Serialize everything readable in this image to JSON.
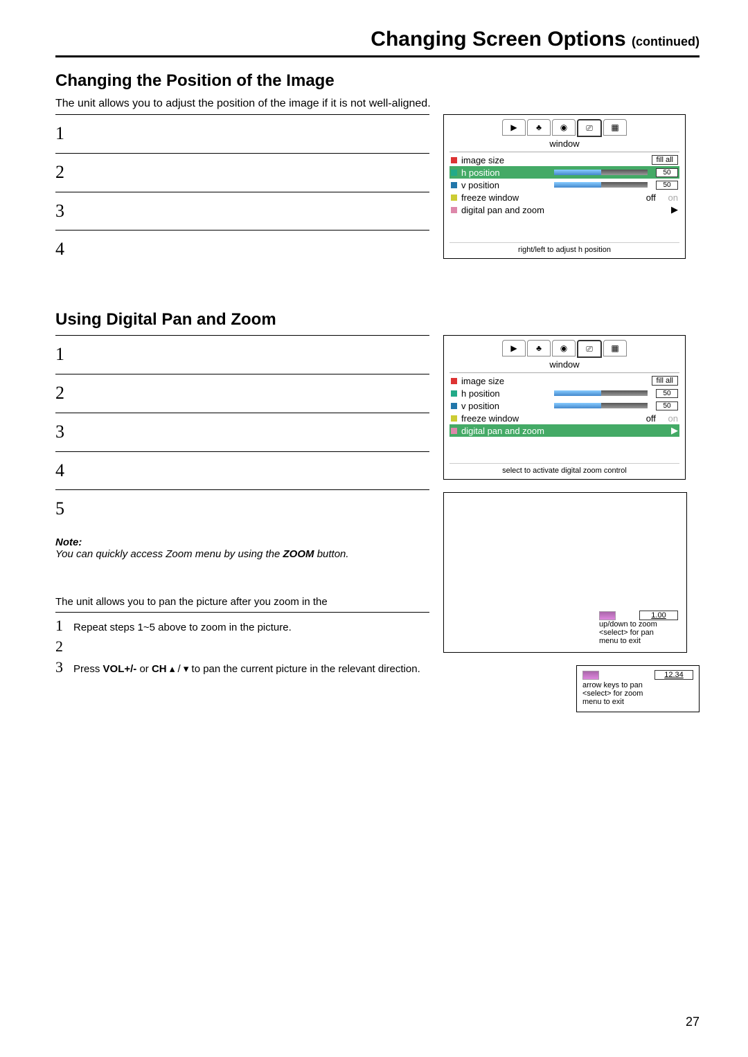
{
  "header": {
    "title": "Changing Screen Options",
    "suffix": "(continued)"
  },
  "section1": {
    "title": "Changing the Position of the Image",
    "intro": "The unit allows you to adjust the position of the image if it is not well-aligned.",
    "steps": [
      "1",
      "2",
      "3",
      "4"
    ]
  },
  "osd1": {
    "tab_title": "window",
    "image_size_label": "image size",
    "image_size_value": "fill all",
    "h_position_label": "h position",
    "h_position_value": "50",
    "v_position_label": "v position",
    "v_position_value": "50",
    "freeze_label": "freeze window",
    "freeze_off": "off",
    "freeze_on": "on",
    "digital_label": "digital pan and zoom",
    "arrow": "▶",
    "hint": "right/left to adjust h position"
  },
  "section2": {
    "title": "Using Digital Pan and Zoom",
    "steps": [
      "1",
      "2",
      "3",
      "4",
      "5"
    ],
    "note_label": "Note:",
    "note_text": "You can quickly access Zoom menu by using the ",
    "note_bold": "ZOOM",
    "note_tail": " button."
  },
  "osd2": {
    "tab_title": "window",
    "image_size_label": "image size",
    "image_size_value": "fill all",
    "h_position_label": "h position",
    "h_position_value": "50",
    "v_position_label": "v position",
    "v_position_value": "50",
    "freeze_label": "freeze window",
    "freeze_off": "off",
    "freeze_on": "on",
    "digital_label": "digital pan and zoom",
    "arrow": "▶",
    "hint": "select to activate digital zoom control"
  },
  "zoom_box": {
    "value": "1.00",
    "line1": "up/down to zoom",
    "line2": "<select> for pan",
    "line3": "menu to exit"
  },
  "pan_section": {
    "intro": "The unit allows you to pan the picture after you zoom in the",
    "step1_num": "1",
    "step1": "Repeat steps 1~5 above to zoom in the picture.",
    "step2_num": "2",
    "step3_num": "3",
    "step3a": "Press ",
    "step3b": "VOL+/-",
    "step3c": " or ",
    "step3d": "CH",
    "step3e": " ▴ / ▾ to pan the current picture in the relevant direction."
  },
  "smallbox": {
    "value": "12.34",
    "line1": "arrow keys to pan",
    "line2": "<select> for zoom",
    "line3": "menu to exit"
  },
  "page_number": "27",
  "icons": {
    "tab1": "▶",
    "tab2": "♣",
    "tab3": "◉",
    "tab4": "⎚",
    "tab5": "▦"
  }
}
